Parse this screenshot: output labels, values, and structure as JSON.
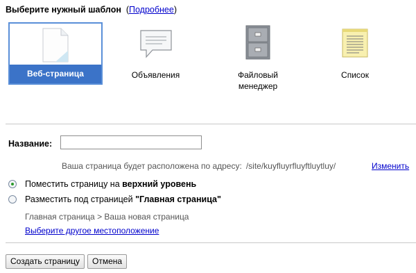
{
  "header": {
    "title": "Выберите нужный шаблон",
    "more_link_open": "(",
    "more_link": "Подробнее",
    "more_link_close": ")"
  },
  "templates": [
    {
      "label": "Веб-страница",
      "icon": "web-page-icon",
      "selected": true
    },
    {
      "label": "Объявления",
      "icon": "speech-bubble-icon",
      "selected": false
    },
    {
      "label_line1": "Файловый",
      "label_line2": "менеджер",
      "icon": "file-cabinet-icon",
      "selected": false
    },
    {
      "label": "Список",
      "icon": "list-note-icon",
      "selected": false
    }
  ],
  "form": {
    "name_label": "Название:",
    "name_value": "",
    "address_text": "Ваша страница будет расположена по адресу:",
    "address_path": "/site/kuyfluyrfluyftluytluy/",
    "change_link": "Изменить"
  },
  "placement": {
    "option_top_prefix": "Поместить страницу на ",
    "option_top_bold": "верхний уровень",
    "option_under_prefix": "Разместить под страницей ",
    "option_under_bold": "\"Главная страница\"",
    "breadcrumb": "Главная страница > Ваша новая страница",
    "other_location_link": "Выберите другое местоположение",
    "selected": "top"
  },
  "buttons": {
    "create": "Создать страницу",
    "cancel": "Отмена"
  },
  "colors": {
    "link": "#0000cc",
    "selected_bg": "#3b73c8",
    "radio_dot": "#2b9a2b"
  }
}
